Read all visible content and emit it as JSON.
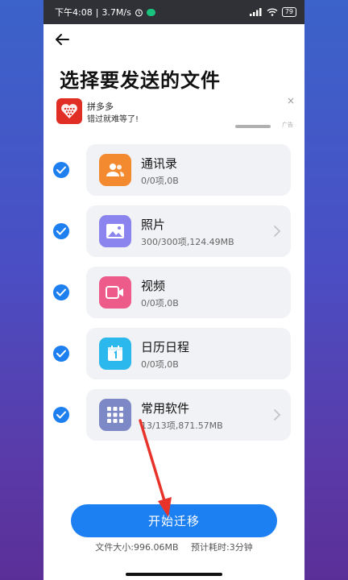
{
  "status_bar": {
    "time": "下午4:08",
    "speed": "3.7M/s",
    "battery": "79"
  },
  "page": {
    "title": "选择要发送的文件"
  },
  "ad": {
    "name": "拼多多",
    "slogan": "错过就难等了!",
    "tag": "广告",
    "close": "×"
  },
  "items": [
    {
      "title": "通讯录",
      "sub": "0/0项,0B",
      "icon": "contacts-icon",
      "color": "#f38a2f",
      "has_arrow": false
    },
    {
      "title": "照片",
      "sub": "300/300项,124.49MB",
      "icon": "image-icon",
      "color": "#8b84ee",
      "has_arrow": true
    },
    {
      "title": "视频",
      "sub": "0/0项,0B",
      "icon": "video-icon",
      "color": "#ec5b89",
      "has_arrow": false
    },
    {
      "title": "日历日程",
      "sub": "0/0项,0B",
      "icon": "calendar-icon",
      "color": "#2bb8ec",
      "has_arrow": false
    },
    {
      "title": "常用软件",
      "sub": "13/13项,871.57MB",
      "icon": "apps-grid-icon",
      "color": "#7d88c6",
      "has_arrow": true
    }
  ],
  "footer": {
    "button_label": "开始迁移",
    "size_text": "文件大小:996.06MB",
    "time_text": "预计耗时:3分钟"
  },
  "colors": {
    "accent": "#1d80f2",
    "annotation_arrow": "#e8332a"
  }
}
